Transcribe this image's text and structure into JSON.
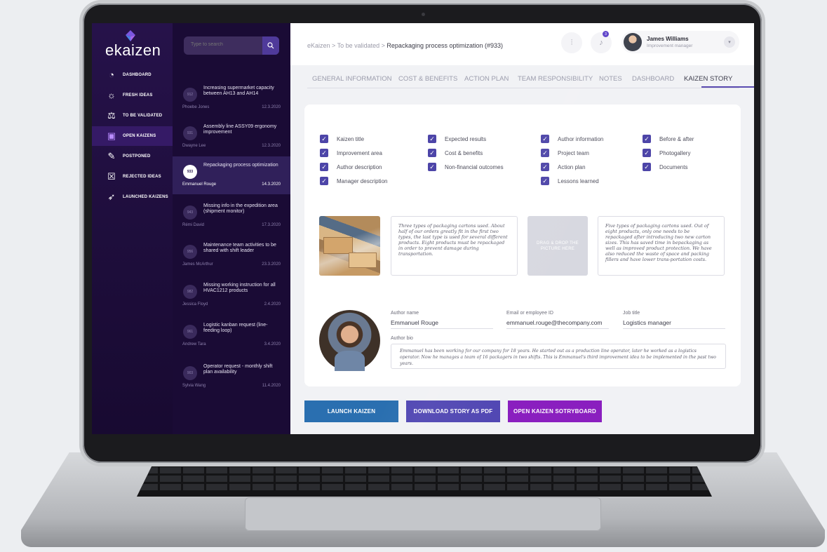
{
  "app": {
    "logo_text": "ekaizen",
    "brand_color": "#5a3fc8"
  },
  "nav": {
    "items": [
      {
        "label": "DASHBOARD",
        "icon": "pie-chart-icon",
        "active": false
      },
      {
        "label": "FRESH IDEAS",
        "icon": "lightbulb-icon",
        "active": false
      },
      {
        "label": "TO BE VALIDATED",
        "icon": "scales-icon",
        "active": false
      },
      {
        "label": "OPEN KAIZENS",
        "icon": "clipboard-icon",
        "active": true
      },
      {
        "label": "POSTPONED",
        "icon": "postpone-icon",
        "active": false
      },
      {
        "label": "REJECTED IDEAS",
        "icon": "rejected-icon",
        "active": false
      },
      {
        "label": "LAUNCHED KAIZENS",
        "icon": "rocket-icon",
        "active": false
      }
    ]
  },
  "search": {
    "placeholder": "Type to search"
  },
  "ideas": [
    {
      "id": "912",
      "title": "Increasing supermarket capacity between AH13 and AH14",
      "author": "Phoebe Jones",
      "date": "12.3.2020",
      "active": false
    },
    {
      "id": "931",
      "title": "Assembly line ASSY09 ergonomy improvement",
      "author": "Dwayne Lee",
      "date": "12.3.2020",
      "active": false
    },
    {
      "id": "933",
      "title": "Repackaging process optimization",
      "author": "Emmanuel Rouge",
      "date": "14.3.2020",
      "active": true
    },
    {
      "id": "943",
      "title": "Missing info in the expedition area (shipment monitor)",
      "author": "Rémi David",
      "date": "17.3.2020",
      "active": false
    },
    {
      "id": "956",
      "title": "Maintenance team activities to be shared with shift leader",
      "author": "James McArthur",
      "date": "23.3.2020",
      "active": false
    },
    {
      "id": "982",
      "title": "Missing working instruction for all HVAC1212 products",
      "author": "Jessica Floyd",
      "date": "2.4.2020",
      "active": false
    },
    {
      "id": "961",
      "title": "Logistic kanban request (line-feeding loop)",
      "author": "Andrew Tara",
      "date": "3.4.2020",
      "active": false
    },
    {
      "id": "903",
      "title": "Operator request - monthly shift plan availability",
      "author": "Sylvia Wang",
      "date": "11.4.2020",
      "active": false
    }
  ],
  "header": {
    "breadcrumb_prefix": "eKaizen > To be validated > ",
    "breadcrumb_current": "Repackaging process optimization (#933)",
    "notification_count": "3",
    "user_name": "James Williams",
    "user_role": "Improvement manager"
  },
  "tabs": [
    {
      "label": "GENERAL INFORMATION",
      "active": false
    },
    {
      "label": "COST & BENEFITS",
      "active": false
    },
    {
      "label": "ACTION PLAN",
      "active": false
    },
    {
      "label": "TEAM RESPONSIBILITY",
      "active": false
    },
    {
      "label": "NOTES",
      "active": false
    },
    {
      "label": "DASHBOARD",
      "active": false
    },
    {
      "label": "KAIZEN STORY",
      "active": true
    }
  ],
  "story_options": [
    [
      "Kaizen title",
      "Improvement area",
      "Author description",
      "Manager description"
    ],
    [
      "Expected results",
      "Cost & benefits",
      "Non-financial outcomes"
    ],
    [
      "Author information",
      "Project team",
      "Action plan",
      "Lessons learned"
    ],
    [
      "Before & after",
      "Photogallery",
      "Documents"
    ]
  ],
  "before_after": {
    "before_text": "Three types of packaging cartons used. About half of our orders greatly fit in the first two types, the last type is used for several different products. Eight products must be repackaged in order to prevent damage during transportation.",
    "dropzone_text": "DRAG & DROP THE PICTURE HERE",
    "after_text": "Five types of packaging cartons used. Out of eight products, only one needs to be repackaged after introducing two new carton sizes. This has saved time in bepackaging as well as improved product protection. We have also reduced the waste of space and packing fillers and have lower trans-portation costs."
  },
  "author": {
    "name_label": "Author name",
    "name": "Emmanuel Rouge",
    "email_label": "Email or employee ID",
    "email": "emmanuel.rouge@thecompany.com",
    "job_label": "Job title",
    "job": "Logistics manager",
    "bio_label": "Author bio",
    "bio": "Emmanuel has been working for our company for 18 years. He started out as a production line operator, later he worked as a logistics operator. Now he manages a team of 16 packagers in two shifts. This is Emmanuel's third improvement idea to be implemented in the past two years."
  },
  "actions": {
    "launch": "LAUNCH KAIZEN",
    "download": "DOWNLOAD STORY AS PDF",
    "storyboard": "OPEN KAIZEN SOTRYBOARD",
    "launch_color": "#2a6fb0",
    "download_color": "#5147b3",
    "storyboard_color": "#8a1fbf"
  }
}
